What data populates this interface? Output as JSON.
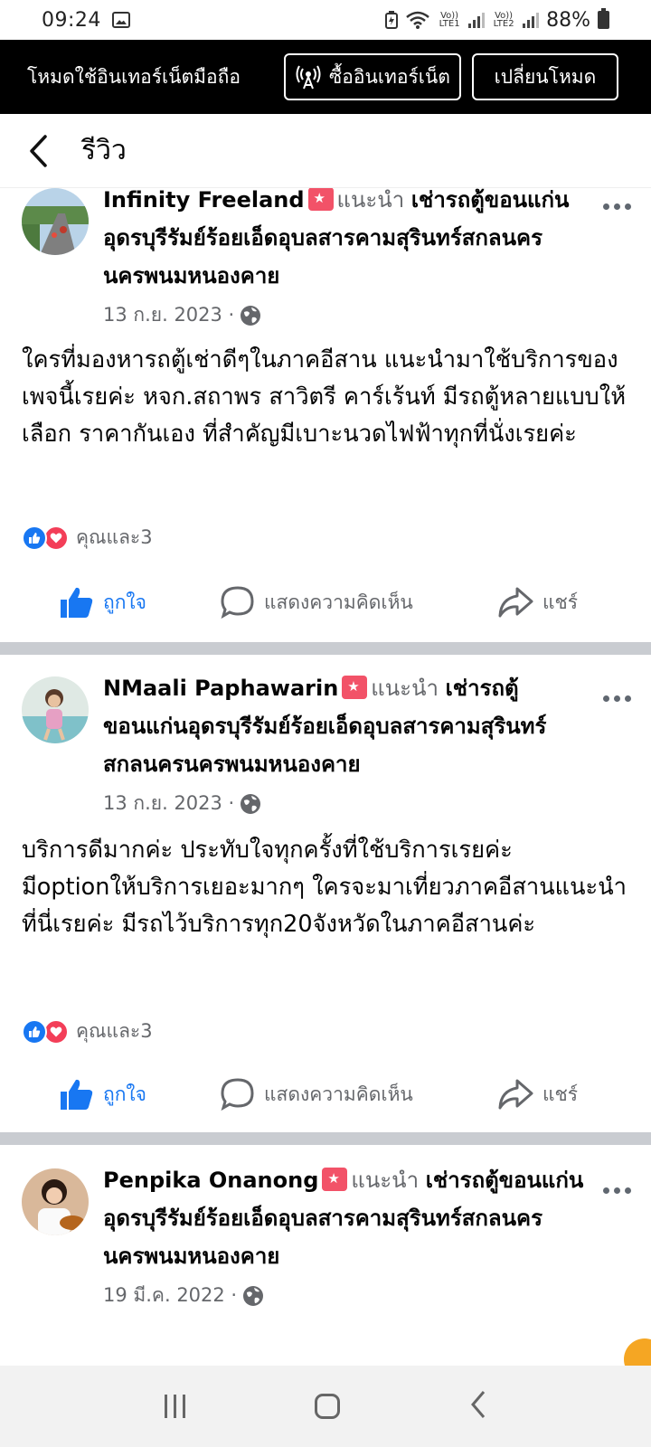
{
  "status_bar": {
    "time": "09:24",
    "sim1": "Vo)) LTE1",
    "sim2": "Vo)) LTE2",
    "battery": "88%"
  },
  "mode_bar": {
    "text": "โหมดใช้อินเทอร์เน็ตมือถือ",
    "buy_label": "ซื้ออินเทอร์เน็ต",
    "switch_label": "เปลี่ยนโหมด"
  },
  "header": {
    "title": "รีวิว"
  },
  "posts": [
    {
      "author": "Infinity Freeland",
      "recommends": "แนะนำ",
      "page": "เช่ารถตู้ขอนแก่นอุดรบุรีรัมย์ร้อยเอ็ดอุบลสารคามสุรินทร์สกลนครนครพนมหนองคาย",
      "date": "13 ก.ย. 2023 ·",
      "text": "ใครที่มองหารถตู้เช่าดีๆในภาคอีสาน แนะนำมาใช้บริการของเพจนี้เรยค่ะ หจก.สถาพร สาวิตรี คาร์เร้นท์ มีรถตู้หลายแบบให้เลือก ราคากันเอง ที่สำคัญมีเบาะนวดไฟฟ้าทุกที่นั่งเรยค่ะ",
      "reactions": "คุณและ3"
    },
    {
      "author": "NMaali Paphawarin",
      "recommends": "แนะนำ",
      "page": "เช่ารถตู้ขอนแก่นอุดรบุรีรัมย์ร้อยเอ็ดอุบลสารคามสุรินทร์สกลนครนครพนมหนองคาย",
      "date": "13 ก.ย. 2023 ·",
      "text": "บริการดีมากค่ะ ประทับใจทุกครั้งที่ใช้บริการเรยค่ะ มีoptionให้บริการเยอะมากๆ ใครจะมาเที่ยวภาคอีสานแนะนำที่นี่เรยค่ะ มีรถไว้บริการทุก20จังหวัดในภาคอีสานค่ะ",
      "reactions": "คุณและ3"
    },
    {
      "author": "Penpika Onanong",
      "recommends": "แนะนำ",
      "page": "เช่ารถตู้ขอนแก่นอุดรบุรีรัมย์ร้อยเอ็ดอุบลสารคามสุรินทร์สกลนครนครพนมหนองคาย",
      "date": "19 มี.ค. 2022 ·"
    }
  ],
  "actions": {
    "like": "ถูกใจ",
    "comment": "แสดงความคิดเห็น",
    "share": "แชร์"
  },
  "colors": {
    "accent": "#1877f2",
    "love": "#f33e58",
    "badge": "#f25268",
    "divider": "#c9ccd1"
  }
}
